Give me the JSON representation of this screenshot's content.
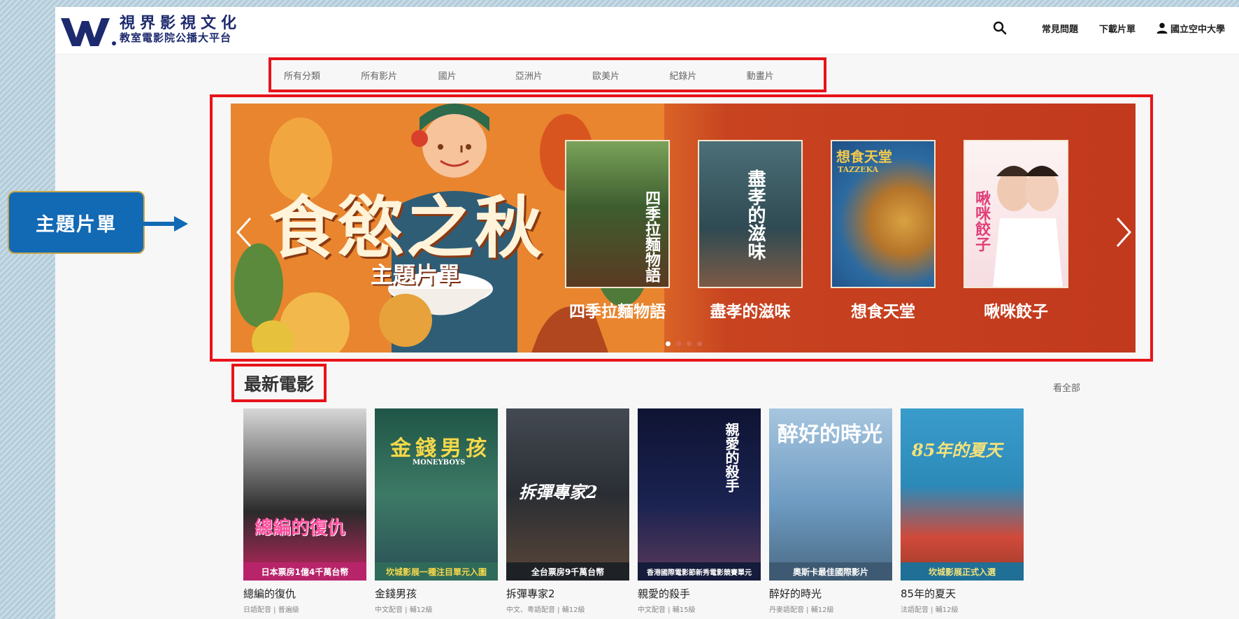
{
  "brand": {
    "name": "視界影視文化",
    "tagline": "教室電影院公播大平台"
  },
  "header": {
    "search_icon": "search-icon",
    "faq": "常見問題",
    "download_list": "下載片單",
    "user_icon": "user-icon",
    "user": "國立空中大學"
  },
  "categories": [
    "所有分類",
    "所有影片",
    "國片",
    "亞洲片",
    "歐美片",
    "紀錄片",
    "動畫片"
  ],
  "callout": "主題片單",
  "banner": {
    "title": "食慾之秋",
    "subtitle": "主題片單",
    "films": [
      {
        "title": "四季拉麵物語",
        "poster_text": "四季拉麵物語"
      },
      {
        "title": "盡孝的滋味",
        "poster_text": "盡孝的滋味"
      },
      {
        "title": "想食天堂",
        "poster_text": "想食天堂",
        "poster_en": "TAZZEKA"
      },
      {
        "title": "啾咪餃子",
        "poster_text": "啾咪餃子"
      }
    ],
    "dots_total": 4,
    "dots_active": 1,
    "prev_icon": "chevron-left-icon",
    "next_icon": "chevron-right-icon"
  },
  "latest": {
    "title": "最新電影",
    "see_all": "看全部",
    "movies": [
      {
        "title": "總編的復仇",
        "info": "日語配音 | 普遍級",
        "band": "日本票房1億4千萬台幣",
        "poster_text": "總編的復仇",
        "color": "#b8246a"
      },
      {
        "title": "金錢男孩",
        "info": "中文配音 | 輔12級",
        "band": "坎城影展一種注目單元入圍",
        "poster_text": "金錢男孩",
        "poster_en": "MONEYBOYS",
        "color": "#2f6b5a"
      },
      {
        "title": "拆彈專家2",
        "info": "中文、粵語配音 | 輔12級",
        "band": "全台票房9千萬台幣",
        "poster_text": "拆彈專家2",
        "color": "#3a3f47"
      },
      {
        "title": "親愛的殺手",
        "info": "中文配音 | 輔15級",
        "band": "香港國際電影節新秀電影競賽單元",
        "poster_text": "親愛的殺手",
        "color": "#151b3a"
      },
      {
        "title": "醉好的時光",
        "info": "丹麥語配音 | 輔12級",
        "band": "奧斯卡最佳國際影片",
        "poster_text": "醉好的時光",
        "color": "#6e9bc2"
      },
      {
        "title": "85年的夏天",
        "info": "法語配音 | 輔12級",
        "band": "坎城影展正式入選",
        "poster_text": "85年的夏天",
        "color": "#2c8ab8"
      }
    ]
  }
}
